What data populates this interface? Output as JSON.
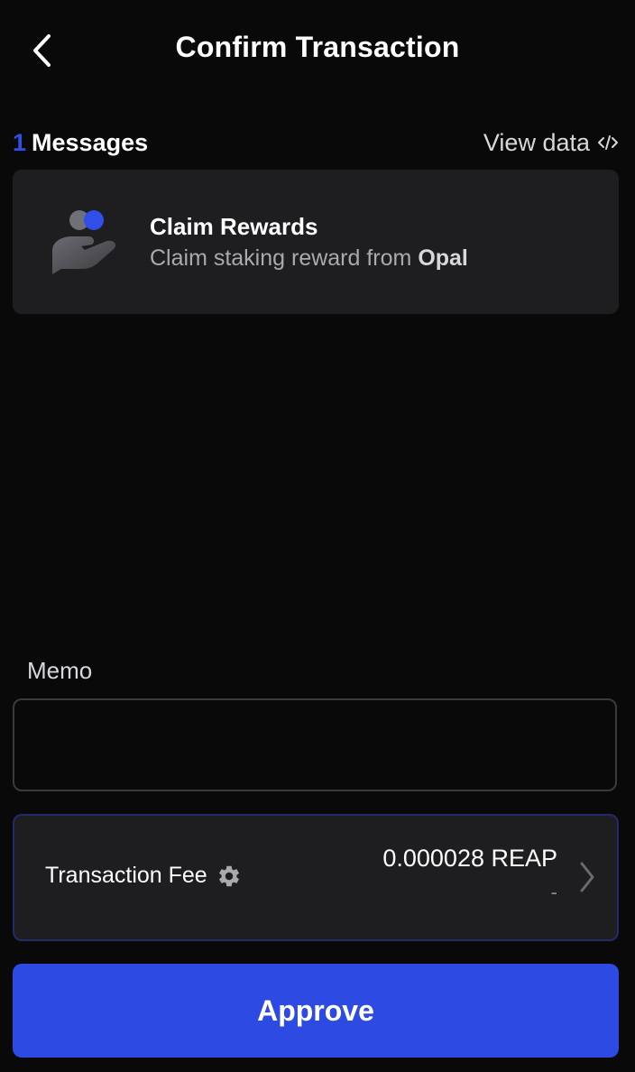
{
  "header": {
    "title": "Confirm Transaction",
    "back_icon": "chevron-left-icon"
  },
  "messages": {
    "count": "1",
    "label": "Messages",
    "view_data_label": "View data",
    "view_data_icon": "code-icon"
  },
  "message_card": {
    "icon": "hand-coins-icon",
    "title": "Claim Rewards",
    "description_prefix": "Claim staking reward from",
    "validator": "Opal"
  },
  "memo": {
    "label": "Memo",
    "value": "",
    "placeholder": ""
  },
  "fee": {
    "label": "Transaction Fee",
    "settings_icon": "gear-icon",
    "amount": "0.000028 REAP",
    "fiat_value": "-",
    "chevron_icon": "chevron-right-icon"
  },
  "approve_label": "Approve",
  "colors": {
    "accent": "#2d4ae3",
    "background": "#09090a",
    "card": "#1e1e21"
  }
}
